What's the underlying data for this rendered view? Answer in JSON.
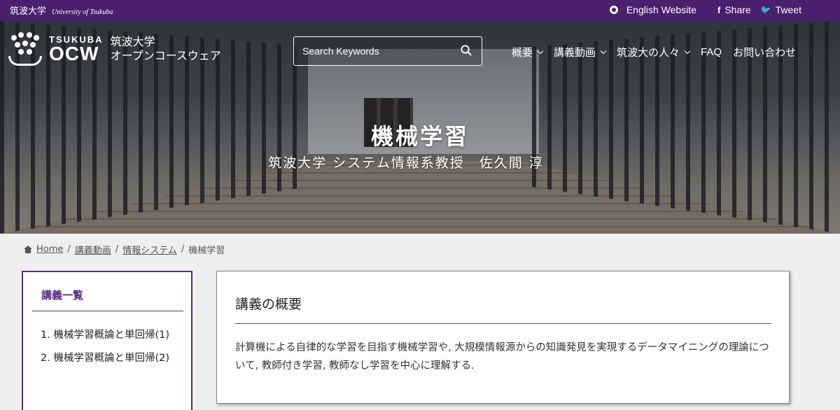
{
  "topbar": {
    "university_jp": "筑波大学",
    "university_en": "University of Tsukuba",
    "english_label": "English Website",
    "share_label": "Share",
    "tweet_label": "Tweet"
  },
  "logo": {
    "tsukuba": "TSUKUBA",
    "ocw": "OCW",
    "jp_line1": "筑波大学",
    "jp_line2": "オープンコースウェア"
  },
  "search": {
    "placeholder": "Search Keywords"
  },
  "nav": {
    "items": [
      {
        "label": "概要",
        "dropdown": true
      },
      {
        "label": "講義動画",
        "dropdown": true
      },
      {
        "label": "筑波大の人々",
        "dropdown": true
      },
      {
        "label": "FAQ",
        "dropdown": false
      },
      {
        "label": "お問い合わせ",
        "dropdown": false
      }
    ]
  },
  "hero": {
    "title": "機械学習",
    "subtitle": "筑波大学 システム情報系教授　佐久間 淳"
  },
  "breadcrumb": {
    "home": "Home",
    "level1": "講義動画",
    "level2": "情報システム",
    "current": "機械学習",
    "separator": "/"
  },
  "sidebar": {
    "heading": "講義一覧",
    "items": [
      "1. 機械学習概論と単回帰(1)",
      "2. 機械学習概論と単回帰(2)"
    ]
  },
  "overview": {
    "title": "講義の概要",
    "description": "計算機による自律的な学習を目指す機械学習や, 大規模情報源からの知識発見を実現するデータマイニングの理論について, 教師付き学習, 教師なし学習を中心に理解する."
  },
  "colors": {
    "brand_purple": "#4a1f6e",
    "accent_purple": "#5a2a82"
  }
}
